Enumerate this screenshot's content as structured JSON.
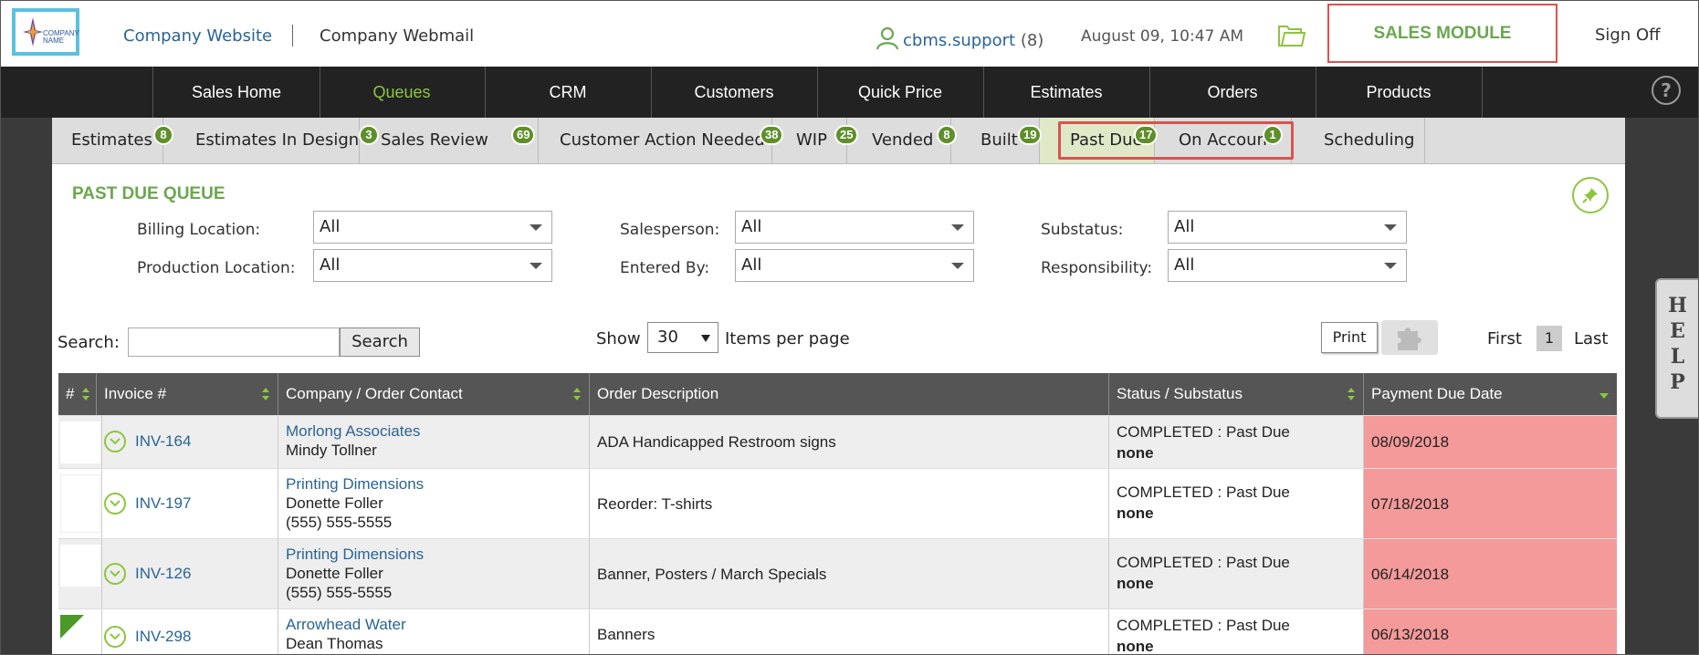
{
  "header": {
    "logo_text": "COMPANY NAME",
    "company_website": "Company Website",
    "company_webmail": "Company Webmail",
    "username": "cbms.support",
    "user_count": "(8)",
    "datetime": "August 09, 10:47 AM",
    "module": "SALES MODULE",
    "sign_off": "Sign Off"
  },
  "nav": {
    "items": [
      "Sales Home",
      "Queues",
      "CRM",
      "Customers",
      "Quick Price",
      "Estimates",
      "Orders",
      "Products"
    ],
    "active": "Queues",
    "help_icon": "?"
  },
  "subtabs": [
    {
      "label": "Estimates",
      "count": "8"
    },
    {
      "label": "Estimates In Design",
      "count": "3"
    },
    {
      "label": "Sales Review",
      "count": "69"
    },
    {
      "label": "Customer Action Needed",
      "count": "38"
    },
    {
      "label": "WIP",
      "count": "25"
    },
    {
      "label": "Vended",
      "count": "8"
    },
    {
      "label": "Built",
      "count": "19"
    },
    {
      "label": "Past Due",
      "count": "17"
    },
    {
      "label": "On Account",
      "count": "1"
    },
    {
      "label": "Scheduling",
      "count": ""
    }
  ],
  "queue": {
    "title": "PAST DUE QUEUE",
    "filters": {
      "billing_location_label": "Billing Location:",
      "billing_location_value": "All",
      "production_location_label": "Production Location:",
      "production_location_value": "All",
      "salesperson_label": "Salesperson:",
      "salesperson_value": "All",
      "entered_by_label": "Entered By:",
      "entered_by_value": "All",
      "substatus_label": "Substatus:",
      "substatus_value": "All",
      "responsibility_label": "Responsibility:",
      "responsibility_value": "All"
    },
    "search_label": "Search:",
    "search_value": "",
    "search_button": "Search",
    "show_label": "Show",
    "per_page": "30",
    "items_per_page_label": "Items per page",
    "print_button": "Print",
    "pager": {
      "first": "First",
      "current": "1",
      "last": "Last"
    }
  },
  "table": {
    "headers": [
      "#",
      "Invoice #",
      "Company / Order Contact",
      "Order Description",
      "Status / Substatus",
      "Payment Due Date"
    ],
    "rows": [
      {
        "invoice": "INV-164",
        "company": "Morlong Associates",
        "contact": "Mindy Tollner",
        "phone": "",
        "description": "ADA Handicapped Restroom signs",
        "status": "COMPLETED : Past Due",
        "substatus": "none",
        "due": "08/09/2018"
      },
      {
        "invoice": "INV-197",
        "company": "Printing Dimensions",
        "contact": "Donette Foller",
        "phone": "(555) 555-5555",
        "description": "Reorder: T-shirts",
        "status": "COMPLETED : Past Due",
        "substatus": "none",
        "due": "07/18/2018"
      },
      {
        "invoice": "INV-126",
        "company": "Printing Dimensions",
        "contact": "Donette Foller",
        "phone": "(555) 555-5555",
        "description": "Banner, Posters / March Specials",
        "status": "COMPLETED : Past Due",
        "substatus": "none",
        "due": "06/14/2018"
      },
      {
        "invoice": "INV-298",
        "company": "Arrowhead Water",
        "contact": "Dean Thomas",
        "phone": "",
        "description": "Banners",
        "status": "COMPLETED : Past Due",
        "substatus": "none",
        "due": "06/13/2018"
      }
    ]
  },
  "help_tab": [
    "H",
    "E",
    "L",
    "P"
  ],
  "colors": {
    "accent_green": "#8cc63f",
    "title_green": "#6aa84f",
    "past_due_red": "#f49a9a",
    "highlight_red": "#d9534f",
    "link_blue": "#2a6496"
  }
}
